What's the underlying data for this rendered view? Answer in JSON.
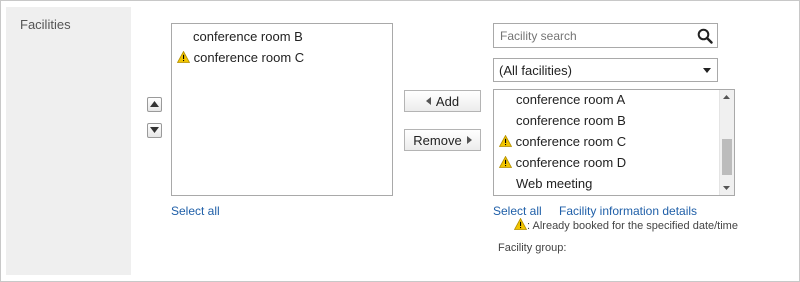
{
  "row_label": "Facilities",
  "selected": {
    "items": [
      {
        "label": "conference room B",
        "warning": false
      },
      {
        "label": "conference room C",
        "warning": true
      }
    ],
    "select_all": "Select all"
  },
  "actions": {
    "add": "Add",
    "remove": "Remove"
  },
  "search": {
    "placeholder": "Facility search",
    "value": ""
  },
  "filter": {
    "selected": "(All facilities)"
  },
  "available": {
    "items": [
      {
        "label": "conference room A",
        "warning": false
      },
      {
        "label": "conference room B",
        "warning": false
      },
      {
        "label": "conference room C",
        "warning": true
      },
      {
        "label": "conference room D",
        "warning": true
      },
      {
        "label": "Web meeting",
        "warning": false
      }
    ],
    "select_all": "Select all",
    "details_link": "Facility information details"
  },
  "legend_note": ": Already booked for the specified date/time",
  "facility_group_label": "Facility group:",
  "colors": {
    "warning": "#f2c500",
    "link": "#1f5fa8",
    "label_bg": "#efefef"
  },
  "icons": {
    "warning": "warning-triangle-icon",
    "search": "magnifier-icon",
    "up": "triangle-up-icon",
    "down": "triangle-down-icon"
  }
}
